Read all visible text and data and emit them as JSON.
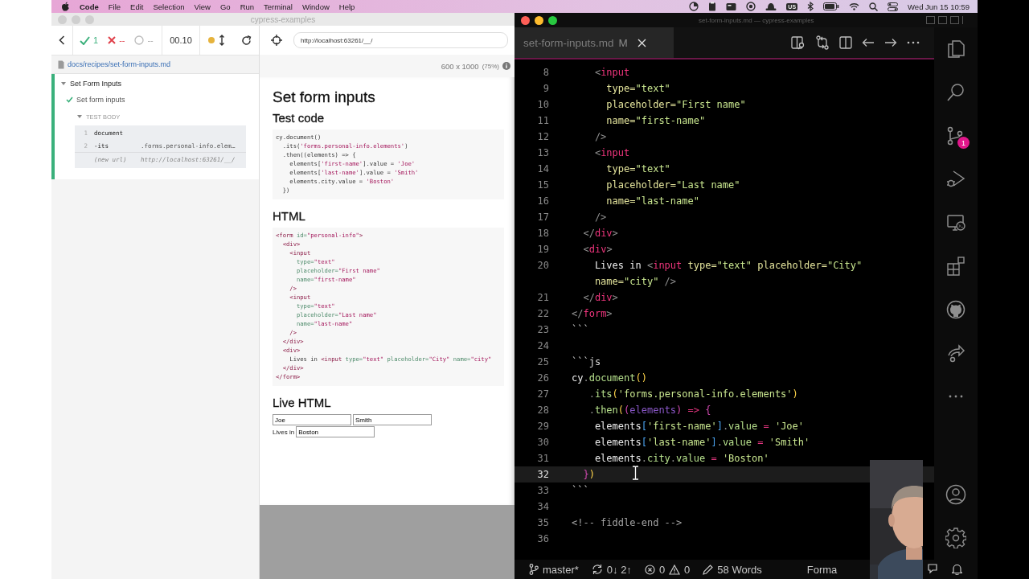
{
  "menu_bar": {
    "app": "Code",
    "items": [
      "File",
      "Edit",
      "Selection",
      "View",
      "Go",
      "Run",
      "Terminal",
      "Window",
      "Help"
    ],
    "keyboard": "US",
    "clock": "Wed Jun 15  10:59"
  },
  "cypress_window": {
    "title": "cypress-examples",
    "stats": {
      "passed": "1",
      "failed": "--",
      "pending": "--",
      "duration": "00.10"
    },
    "spec_path": "docs/recipes/set-form-inputs.md",
    "suite": {
      "title": "Set Form Inputs",
      "expanded": true
    },
    "test": {
      "title": "Set form inputs",
      "passed": true
    },
    "test_body": {
      "label": "TEST BODY",
      "expanded": true,
      "commands": [
        {
          "kind": "command",
          "number": "1",
          "name": "document"
        },
        {
          "kind": "command",
          "number": "2",
          "name": "-its",
          "message": ".forms.personal-info.elem…"
        },
        {
          "kind": "event",
          "name": "(new url)",
          "message": "http://localhost:63261/__/"
        }
      ]
    },
    "url": "http://localhost:63261/__/",
    "viewport": "600 x 1000",
    "scale": "(75%)",
    "app": {
      "title": "Set form inputs",
      "test_code_heading": "Test code",
      "test_code": [
        [
          {
            "kind": "plain",
            "text": "cy.document()"
          }
        ],
        [
          {
            "kind": "plain",
            "text": "  .its("
          },
          {
            "kind": "string",
            "text": "'forms.personal-info.elements'"
          },
          {
            "kind": "plain",
            "text": ")"
          }
        ],
        [
          {
            "kind": "plain",
            "text": "  .then((elements) => {"
          }
        ],
        [
          {
            "kind": "plain",
            "text": "    elements["
          },
          {
            "kind": "string",
            "text": "'first-name'"
          },
          {
            "kind": "plain",
            "text": "].value = "
          },
          {
            "kind": "string",
            "text": "'Joe'"
          }
        ],
        [
          {
            "kind": "plain",
            "text": "    elements["
          },
          {
            "kind": "string",
            "text": "'last-name'"
          },
          {
            "kind": "plain",
            "text": "].value = "
          },
          {
            "kind": "string",
            "text": "'Smith'"
          }
        ],
        [
          {
            "kind": "plain",
            "text": "    elements.city.value = "
          },
          {
            "kind": "string",
            "text": "'Boston'"
          }
        ],
        [
          {
            "kind": "plain",
            "text": "  })"
          }
        ]
      ],
      "html_heading": "HTML",
      "html_code": [
        [
          {
            "kind": "tag",
            "text": "<form"
          },
          {
            "kind": "attr",
            "text": " id="
          },
          {
            "kind": "string",
            "text": "\"personal-info\""
          },
          {
            "kind": "tag",
            "text": ">"
          }
        ],
        [
          {
            "kind": "tag",
            "text": "  <div>"
          }
        ],
        [
          {
            "kind": "tag",
            "text": "    <input"
          }
        ],
        [
          {
            "kind": "attr",
            "text": "      type="
          },
          {
            "kind": "string",
            "text": "\"text\""
          }
        ],
        [
          {
            "kind": "attr",
            "text": "      placeholder="
          },
          {
            "kind": "string",
            "text": "\"First name\""
          }
        ],
        [
          {
            "kind": "attr",
            "text": "      name="
          },
          {
            "kind": "string",
            "text": "\"first-name\""
          }
        ],
        [
          {
            "kind": "tag",
            "text": "    />"
          }
        ],
        [
          {
            "kind": "tag",
            "text": "    <input"
          }
        ],
        [
          {
            "kind": "attr",
            "text": "      type="
          },
          {
            "kind": "string",
            "text": "\"text\""
          }
        ],
        [
          {
            "kind": "attr",
            "text": "      placeholder="
          },
          {
            "kind": "string",
            "text": "\"Last name\""
          }
        ],
        [
          {
            "kind": "attr",
            "text": "      name="
          },
          {
            "kind": "string",
            "text": "\"last-name\""
          }
        ],
        [
          {
            "kind": "tag",
            "text": "    />"
          }
        ],
        [
          {
            "kind": "tag",
            "text": "  </div>"
          }
        ],
        [
          {
            "kind": "tag",
            "text": "  <div>"
          }
        ],
        [
          {
            "kind": "plain",
            "text": "    Lives in "
          },
          {
            "kind": "tag",
            "text": "<input"
          },
          {
            "kind": "attr",
            "text": " type="
          },
          {
            "kind": "string",
            "text": "\"text\""
          },
          {
            "kind": "attr",
            "text": " placeholder="
          },
          {
            "kind": "string",
            "text": "\"City\""
          },
          {
            "kind": "attr",
            "text": " name="
          },
          {
            "kind": "string",
            "text": "\"city\""
          }
        ],
        [
          {
            "kind": "tag",
            "text": "  </div>"
          }
        ],
        [
          {
            "kind": "tag",
            "text": "</form>"
          }
        ]
      ],
      "live_heading": "Live HTML",
      "first_name": "Joe",
      "last_name": "Smith",
      "city_label": "Lives in",
      "city": "Boston"
    }
  },
  "editor": {
    "title": "set-form-inputs.md — cypress-examples",
    "tab": {
      "label": "set-form-inputs.md",
      "badge": "M",
      "selected": true
    },
    "lines": [
      {
        "number": "8",
        "current": false,
        "tokens": [
          {
            "kind": "punct",
            "text": "    <"
          },
          {
            "kind": "tag",
            "text": "input"
          }
        ]
      },
      {
        "number": "9",
        "current": false,
        "tokens": [
          {
            "kind": "attr",
            "text": "      type="
          },
          {
            "kind": "string",
            "text": "\"text\""
          }
        ]
      },
      {
        "number": "10",
        "current": false,
        "tokens": [
          {
            "kind": "attr",
            "text": "      placeholder="
          },
          {
            "kind": "string",
            "text": "\"First name\""
          }
        ]
      },
      {
        "number": "11",
        "current": false,
        "tokens": [
          {
            "kind": "attr",
            "text": "      name="
          },
          {
            "kind": "string",
            "text": "\"first-name\""
          }
        ]
      },
      {
        "number": "12",
        "current": false,
        "tokens": [
          {
            "kind": "punct",
            "text": "    />"
          }
        ]
      },
      {
        "number": "13",
        "current": false,
        "tokens": [
          {
            "kind": "punct",
            "text": "    <"
          },
          {
            "kind": "tag",
            "text": "input"
          }
        ]
      },
      {
        "number": "14",
        "current": false,
        "tokens": [
          {
            "kind": "attr",
            "text": "      type="
          },
          {
            "kind": "string",
            "text": "\"text\""
          }
        ]
      },
      {
        "number": "15",
        "current": false,
        "tokens": [
          {
            "kind": "attr",
            "text": "      placeholder="
          },
          {
            "kind": "string",
            "text": "\"Last name\""
          }
        ]
      },
      {
        "number": "16",
        "current": false,
        "tokens": [
          {
            "kind": "attr",
            "text": "      name="
          },
          {
            "kind": "string",
            "text": "\"last-name\""
          }
        ]
      },
      {
        "number": "17",
        "current": false,
        "tokens": [
          {
            "kind": "punct",
            "text": "    />"
          }
        ]
      },
      {
        "number": "18",
        "current": false,
        "tokens": [
          {
            "kind": "punct",
            "text": "  </"
          },
          {
            "kind": "tag",
            "text": "div"
          },
          {
            "kind": "punct",
            "text": ">"
          }
        ]
      },
      {
        "number": "19",
        "current": false,
        "tokens": [
          {
            "kind": "punct",
            "text": "  <"
          },
          {
            "kind": "tag",
            "text": "div"
          },
          {
            "kind": "punct",
            "text": ">"
          }
        ]
      },
      {
        "number": "20",
        "current": false,
        "tokens": [
          {
            "kind": "plain",
            "text": "    Lives in "
          },
          {
            "kind": "punct",
            "text": "<"
          },
          {
            "kind": "tag",
            "text": "input"
          },
          {
            "kind": "attr",
            "text": " type="
          },
          {
            "kind": "string",
            "text": "\"text\""
          },
          {
            "kind": "attr",
            "text": " placeholder="
          },
          {
            "kind": "string",
            "text": "\"City\""
          }
        ]
      },
      {
        "current": false,
        "tokens": [
          {
            "kind": "attr",
            "text": "    name="
          },
          {
            "kind": "string",
            "text": "\"city\""
          },
          {
            "kind": "punct",
            "text": " />"
          }
        ]
      },
      {
        "number": "21",
        "current": false,
        "tokens": [
          {
            "kind": "punct",
            "text": "  </"
          },
          {
            "kind": "tag",
            "text": "div"
          },
          {
            "kind": "punct",
            "text": ">"
          }
        ]
      },
      {
        "number": "22",
        "current": false,
        "tokens": [
          {
            "kind": "punct",
            "text": "</"
          },
          {
            "kind": "tag",
            "text": "form"
          },
          {
            "kind": "punct",
            "text": ">"
          }
        ]
      },
      {
        "number": "23",
        "current": false,
        "tokens": [
          {
            "kind": "fence",
            "text": "```"
          }
        ]
      },
      {
        "number": "24",
        "current": false
      },
      {
        "number": "25",
        "current": false,
        "tokens": [
          {
            "kind": "fence",
            "text": "```js"
          }
        ]
      },
      {
        "number": "26",
        "current": false,
        "tokens": [
          {
            "kind": "plain",
            "text": "cy"
          },
          {
            "kind": "punct",
            "text": "."
          },
          {
            "kind": "function",
            "text": "document"
          },
          {
            "kind": "bracket1",
            "text": "()"
          }
        ]
      },
      {
        "number": "27",
        "current": false,
        "tokens": [
          {
            "kind": "punct",
            "text": "   ."
          },
          {
            "kind": "function",
            "text": "its"
          },
          {
            "kind": "bracket1",
            "text": "("
          },
          {
            "kind": "string",
            "text": "'forms.personal-info.elements'"
          },
          {
            "kind": "bracket1",
            "text": ")"
          }
        ]
      },
      {
        "number": "28",
        "current": false,
        "tokens": [
          {
            "kind": "punct",
            "text": "   ."
          },
          {
            "kind": "function",
            "text": "then"
          },
          {
            "kind": "bracket1",
            "text": "("
          },
          {
            "kind": "bracket2",
            "text": "("
          },
          {
            "kind": "param",
            "text": "elements"
          },
          {
            "kind": "bracket2",
            "text": ")"
          },
          {
            "kind": "operator",
            "text": " => "
          },
          {
            "kind": "bracket2",
            "text": "{"
          }
        ]
      },
      {
        "number": "29",
        "current": false,
        "tokens": [
          {
            "kind": "plain",
            "text": "    elements"
          },
          {
            "kind": "bracket3",
            "text": "["
          },
          {
            "kind": "string",
            "text": "'first-name'"
          },
          {
            "kind": "bracket3",
            "text": "]"
          },
          {
            "kind": "punct",
            "text": "."
          },
          {
            "kind": "property",
            "text": "value"
          },
          {
            "kind": "operator",
            "text": " = "
          },
          {
            "kind": "string",
            "text": "'Joe'"
          }
        ]
      },
      {
        "number": "30",
        "current": false,
        "tokens": [
          {
            "kind": "plain",
            "text": "    elements"
          },
          {
            "kind": "bracket3",
            "text": "["
          },
          {
            "kind": "string",
            "text": "'last-name'"
          },
          {
            "kind": "bracket3",
            "text": "]"
          },
          {
            "kind": "punct",
            "text": "."
          },
          {
            "kind": "property",
            "text": "value"
          },
          {
            "kind": "operator",
            "text": " = "
          },
          {
            "kind": "string",
            "text": "'Smith'"
          }
        ]
      },
      {
        "number": "31",
        "current": false,
        "tokens": [
          {
            "kind": "plain",
            "text": "    elements"
          },
          {
            "kind": "punct",
            "text": "."
          },
          {
            "kind": "property",
            "text": "city"
          },
          {
            "kind": "punct",
            "text": "."
          },
          {
            "kind": "property",
            "text": "value"
          },
          {
            "kind": "operator",
            "text": " = "
          },
          {
            "kind": "string",
            "text": "'Boston'"
          }
        ]
      },
      {
        "number": "32",
        "current": true,
        "tokens": [
          {
            "kind": "bracket2",
            "text": "  }"
          },
          {
            "kind": "bracket1",
            "text": ")"
          }
        ]
      },
      {
        "number": "33",
        "current": false,
        "tokens": [
          {
            "kind": "fence",
            "text": "```"
          }
        ]
      },
      {
        "number": "34",
        "current": false
      },
      {
        "number": "35",
        "current": false,
        "tokens": [
          {
            "kind": "comment",
            "text": "<!-- fiddle-end -->"
          }
        ]
      },
      {
        "number": "36",
        "current": false
      }
    ],
    "source_control_badge": "1"
  },
  "status_bar": {
    "branch": "master*",
    "sync": "0↓ 2↑",
    "errors": "0",
    "warnings": "0",
    "words": "58 Words",
    "format": "Forma"
  }
}
